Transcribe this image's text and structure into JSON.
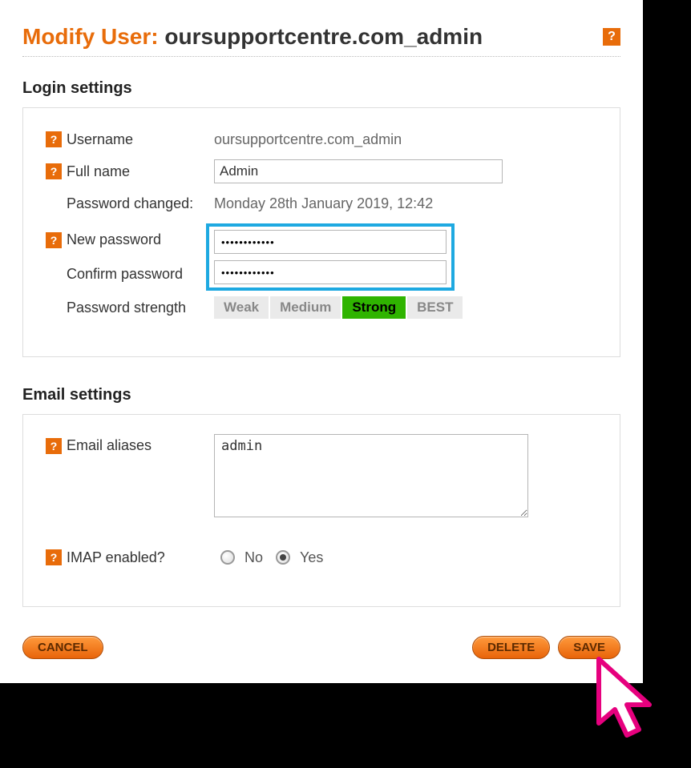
{
  "header": {
    "title_prefix": "Modify User: ",
    "title_value": "oursupportcentre.com_admin"
  },
  "login_section": {
    "heading": "Login settings",
    "username_label": "Username",
    "username_value": "oursupportcentre.com_admin",
    "fullname_label": "Full name",
    "fullname_value": "Admin",
    "password_changed_label": "Password changed:",
    "password_changed_value": "Monday 28th January 2019, 12:42",
    "new_password_label": "New password",
    "new_password_value": "••••••••••••",
    "confirm_password_label": "Confirm password",
    "confirm_password_value": "••••••••••••",
    "strength_label": "Password strength",
    "strength_levels": {
      "weak": "Weak",
      "medium": "Medium",
      "strong": "Strong",
      "best": "BEST"
    },
    "strength_active": "strong"
  },
  "email_section": {
    "heading": "Email settings",
    "aliases_label": "Email aliases",
    "aliases_value": "admin",
    "imap_label": "IMAP enabled?",
    "imap_no": "No",
    "imap_yes": "Yes",
    "imap_selected": "yes"
  },
  "buttons": {
    "cancel": "CANCEL",
    "delete": "DELETE",
    "save": "SAVE"
  }
}
